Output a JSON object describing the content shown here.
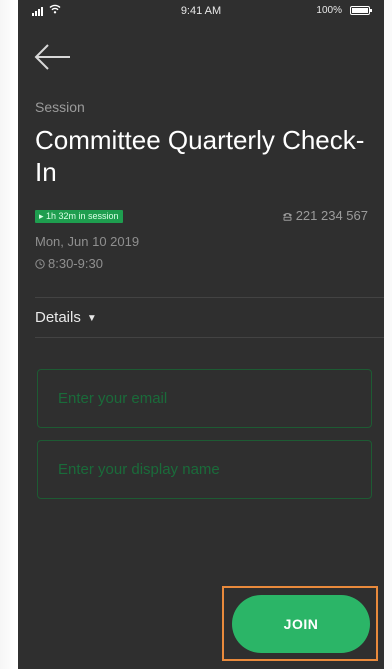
{
  "status_bar": {
    "time": "9:41 AM",
    "battery": "100%"
  },
  "session": {
    "label": "Session",
    "title": "Committee Quarterly Check-In",
    "badge": "▸ 1h 32m in session",
    "meeting_id": "221 234 567",
    "date": "Mon, Jun 10 2019",
    "time": "8:30-9:30"
  },
  "details": {
    "label": "Details",
    "caret": "▼"
  },
  "form": {
    "email_placeholder": "Enter your email",
    "name_placeholder": "Enter your display name"
  },
  "actions": {
    "join_label": "JOIN"
  },
  "icons": {
    "back": "arrow-left-icon",
    "phone": "phone-icon",
    "clock": "clock-icon"
  },
  "colors": {
    "background": "#2f2f2f",
    "accent_green": "#2bb567",
    "badge_green": "#1e9e4f",
    "field_border": "#1d5b33",
    "highlight_orange": "#e98a3c"
  }
}
